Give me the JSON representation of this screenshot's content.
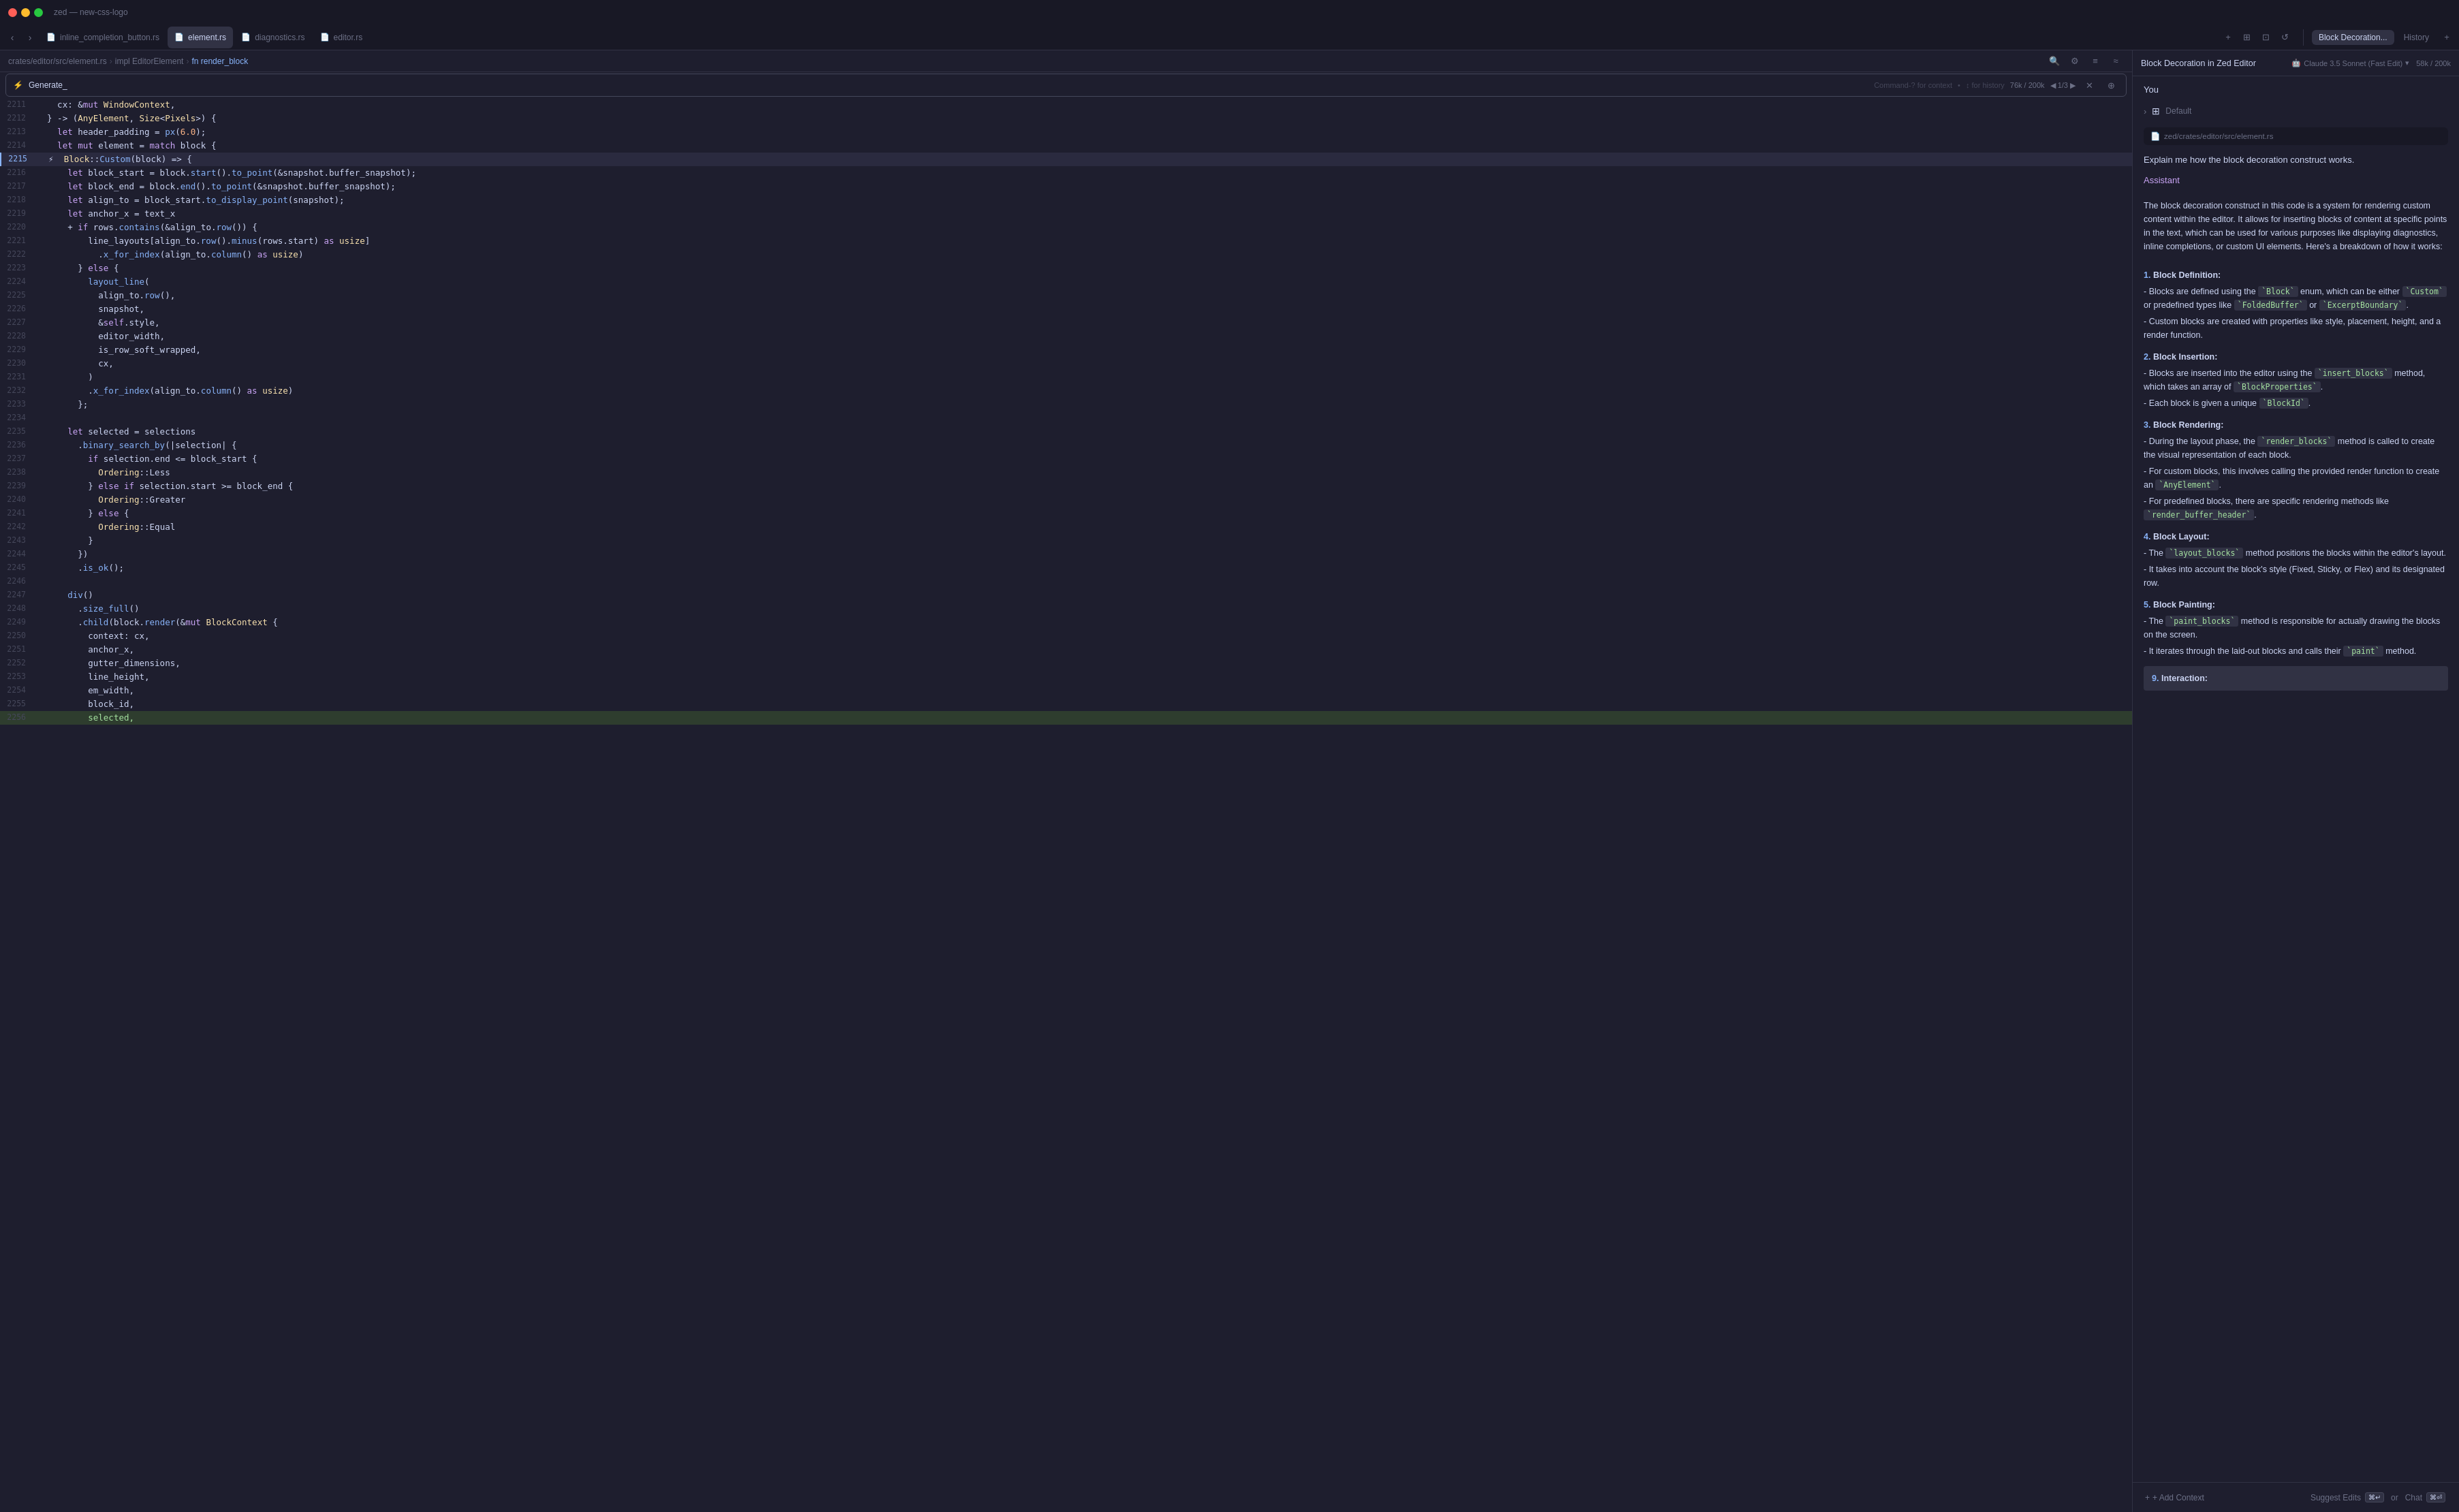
{
  "app": {
    "title": "zed — new-css-logo",
    "traffic_lights": [
      "red",
      "yellow",
      "green"
    ]
  },
  "tab_bar": {
    "back_label": "‹",
    "forward_label": "›",
    "tabs": [
      {
        "id": "inline_completion_button",
        "label": "inline_completion_button.rs",
        "icon": "📄",
        "active": false
      },
      {
        "id": "element",
        "label": "element.rs",
        "icon": "📄",
        "active": true
      },
      {
        "id": "diagnostics",
        "label": "diagnostics.rs",
        "icon": "📄",
        "active": false
      },
      {
        "id": "editor",
        "label": "editor.rs",
        "icon": "📄",
        "active": false
      }
    ],
    "add_tab_label": "+",
    "actions": [
      "+",
      "⊞",
      "⊡",
      "↺"
    ]
  },
  "ai_panel_tabs": {
    "decoration_label": "Block Decoration...",
    "history_label": "History",
    "add_label": "+"
  },
  "breadcrumb": {
    "path": "crates/editor/src/element.rs",
    "sep1": "›",
    "impl_label": "impl EditorElement",
    "sep2": "›",
    "fn_label": "fn render_block"
  },
  "breadcrumb_actions": [
    "🔍",
    "⚙",
    "≡",
    "≈"
  ],
  "inline_prompt": {
    "icon": "⚡",
    "input_value": "Generate_",
    "hints": [
      "Command-? for context",
      "↕ for history"
    ],
    "dot": "•",
    "tokens": "76k / 200k",
    "nav": "1/3",
    "close": "✕",
    "expand": "⊕"
  },
  "code_lines": [
    {
      "num": "2211",
      "content": "    cx: &mut WindowContext,",
      "active": false
    },
    {
      "num": "2212",
      "content": "  } -> (AnyElement, Size<Pixels>) {",
      "active": false
    },
    {
      "num": "2213",
      "content": "    let header_padding = px(6.0);",
      "active": false
    },
    {
      "num": "2214",
      "content": "    let mut element = match block {",
      "active": false
    },
    {
      "num": "2215",
      "content": "Block::Custom(block) => {",
      "active": true,
      "active_indicator": "⚡"
    },
    {
      "num": "2216",
      "content": "      let block_start = block.start().to_point(&snapshot.buffer_snapshot);",
      "active": false
    },
    {
      "num": "2217",
      "content": "      let block_end = block.end().to_point(&snapshot.buffer_snapshot);",
      "active": false
    },
    {
      "num": "2218",
      "content": "      let align_to = block_start.to_display_point(snapshot);",
      "active": false
    },
    {
      "num": "2219",
      "content": "      let anchor_x = text_x",
      "active": false
    },
    {
      "num": "2220",
      "content": "      + if rows.contains(&align_to.row()) {",
      "active": false
    },
    {
      "num": "2221",
      "content": "          line_layouts[align_to.row().minus(rows.start) as usize]",
      "active": false
    },
    {
      "num": "2222",
      "content": "            .x_for_index(align_to.column() as usize)",
      "active": false
    },
    {
      "num": "2223",
      "content": "        } else {",
      "active": false
    },
    {
      "num": "2224",
      "content": "          layout_line(",
      "active": false
    },
    {
      "num": "2225",
      "content": "            align_to.row(),",
      "active": false
    },
    {
      "num": "2226",
      "content": "            snapshot,",
      "active": false
    },
    {
      "num": "2227",
      "content": "            &self.style,",
      "active": false
    },
    {
      "num": "2228",
      "content": "            editor_width,",
      "active": false
    },
    {
      "num": "2229",
      "content": "            is_row_soft_wrapped,",
      "active": false
    },
    {
      "num": "2230",
      "content": "            cx,",
      "active": false
    },
    {
      "num": "2231",
      "content": "          )",
      "active": false
    },
    {
      "num": "2232",
      "content": "          .x_for_index(align_to.column() as usize)",
      "active": false
    },
    {
      "num": "2233",
      "content": "        };",
      "active": false
    },
    {
      "num": "2234",
      "content": "",
      "active": false
    },
    {
      "num": "2235",
      "content": "      let selected = selections",
      "active": false
    },
    {
      "num": "2236",
      "content": "        .binary_search_by(|selection| {",
      "active": false
    },
    {
      "num": "2237",
      "content": "          if selection.end <= block_start {",
      "active": false
    },
    {
      "num": "2238",
      "content": "            Ordering::Less",
      "active": false
    },
    {
      "num": "2239",
      "content": "          } else if selection.start >= block_end {",
      "active": false
    },
    {
      "num": "2240",
      "content": "            Ordering::Greater",
      "active": false
    },
    {
      "num": "2241",
      "content": "          } else {",
      "active": false
    },
    {
      "num": "2242",
      "content": "            Ordering::Equal",
      "active": false
    },
    {
      "num": "2243",
      "content": "          }",
      "active": false
    },
    {
      "num": "2244",
      "content": "        })",
      "active": false
    },
    {
      "num": "2245",
      "content": "        .is_ok();",
      "active": false
    },
    {
      "num": "2246",
      "content": "",
      "active": false
    },
    {
      "num": "2247",
      "content": "      div()",
      "active": false
    },
    {
      "num": "2248",
      "content": "        .size_full()",
      "active": false
    },
    {
      "num": "2249",
      "content": "        .child(block.render(&mut BlockContext {",
      "active": false
    },
    {
      "num": "2250",
      "content": "          context: cx,",
      "active": false
    },
    {
      "num": "2251",
      "content": "          anchor_x,",
      "active": false
    },
    {
      "num": "2252",
      "content": "          gutter_dimensions,",
      "active": false
    },
    {
      "num": "2253",
      "content": "          line_height,",
      "active": false
    },
    {
      "num": "2254",
      "content": "          em_width,",
      "active": false
    },
    {
      "num": "2255",
      "content": "          block_id,",
      "active": false
    },
    {
      "num": "2256",
      "content": "          selected,",
      "active": false
    }
  ],
  "ai_panel": {
    "title": "Block Decoration in Zed Editor",
    "model": "Claude 3.5 Sonnet (Fast Edit)",
    "tokens": "58k / 200k",
    "you_label": "You",
    "context": {
      "toggle": "›",
      "label": "Default"
    },
    "file_ref": {
      "icon": "📄",
      "path": "zed/crates/editor/src/element.rs"
    },
    "user_message": "Explain me how the block decoration construct works.",
    "assistant_label": "Assistant",
    "response_intro": "The block decoration construct in this code is a system for rendering custom content within the editor. It allows for inserting blocks of content at specific points in the text, which can be used for various purposes like displaying diagnostics, inline completions, or custom UI elements. Here's a breakdown of how it works:",
    "numbered_items": [
      {
        "num": "1",
        "title": "Block Definition:",
        "bullets": [
          "Blocks are defined using the `Block` enum, which can be either `Custom` or predefined types like `FoldedBuffer` or `ExcerptBoundary`.",
          "Custom blocks are created with properties like style, placement, height, and a render function."
        ]
      },
      {
        "num": "2",
        "title": "Block Insertion:",
        "bullets": [
          "Blocks are inserted into the editor using the `insert_blocks` method, which takes an array of `BlockProperties`.",
          "Each block is given a unique `BlockId`."
        ]
      },
      {
        "num": "3",
        "title": "Block Rendering:",
        "bullets": [
          "During the layout phase, the `render_blocks` method is called to create the visual representation of each block.",
          "For custom blocks, this involves calling the provided render function to create an `AnyElement`.",
          "For predefined blocks, there are specific rendering methods like `render_buffer_header`."
        ]
      },
      {
        "num": "4",
        "title": "Block Layout:",
        "bullets": [
          "The `layout_blocks` method positions the blocks within the editor's layout.",
          "It takes into account the block's style (Fixed, Sticky, or Flex) and its designated row."
        ]
      },
      {
        "num": "5",
        "title": "Block Painting:",
        "bullets": [
          "The `paint_blocks` method is responsible for actually drawing the blocks on the screen.",
          "It iterates through the laid-out blocks and calls their `paint` method."
        ]
      },
      {
        "num": "9",
        "title": "Interaction:",
        "partial": true
      }
    ]
  },
  "footer": {
    "add_context_label": "+ Add Context",
    "suggest_edits_label": "Suggest Edits",
    "suggest_shortcut": "⌘↵",
    "or_label": "or",
    "chat_label": "Chat",
    "chat_shortcut": "⌘⏎"
  }
}
